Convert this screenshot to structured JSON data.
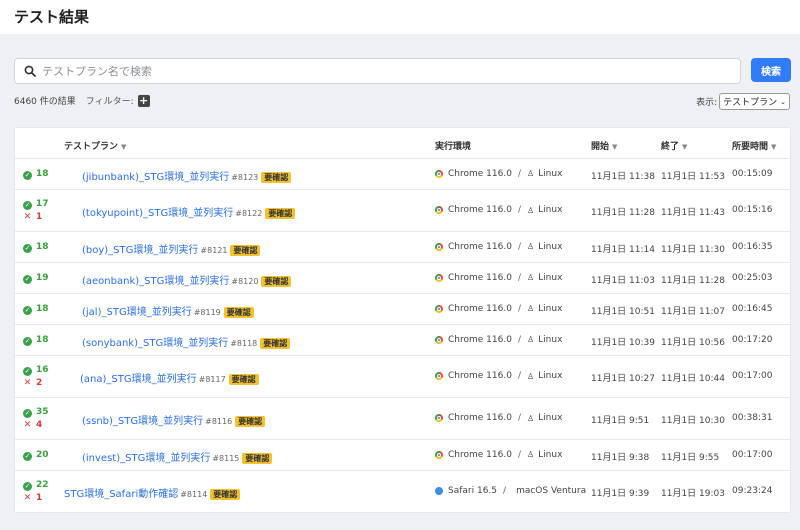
{
  "page": {
    "title": "テスト結果"
  },
  "search": {
    "placeholder": "テストプラン名で検索",
    "button_label": "検索"
  },
  "results": {
    "count_label": "6460 件の結果",
    "filter_label": "フィルター:"
  },
  "display": {
    "label": "表示:",
    "selected": "テストプラン"
  },
  "table": {
    "headers": {
      "plan": "テストプラン",
      "env": "実行環境",
      "start": "開始",
      "end": "終了",
      "duration": "所要時間"
    },
    "rows": [
      {
        "passed": "18",
        "failed": "",
        "plan": "(jibunbank)_STG環境_並列実行",
        "number": "#8123",
        "badge": "要確認",
        "browser": "Chrome 116.0",
        "browser_icon": "chrome-icon",
        "os": "Linux",
        "os_icon": "linux-icon",
        "start": "11月1日 11:38",
        "end": "11月1日 11:53",
        "duration": "00:15:09"
      },
      {
        "passed": "17",
        "failed": "1",
        "plan": "(tokyupoint)_STG環境_並列実行",
        "number": "#8122",
        "badge": "要確認",
        "browser": "Chrome 116.0",
        "browser_icon": "chrome-icon",
        "os": "Linux",
        "os_icon": "linux-icon",
        "start": "11月1日 11:28",
        "end": "11月1日 11:43",
        "duration": "00:15:16"
      },
      {
        "passed": "18",
        "failed": "",
        "plan": "(boy)_STG環境_並列実行",
        "number": "#8121",
        "badge": "要確認",
        "browser": "Chrome 116.0",
        "browser_icon": "chrome-icon",
        "os": "Linux",
        "os_icon": "linux-icon",
        "start": "11月1日 11:14",
        "end": "11月1日 11:30",
        "duration": "00:16:35"
      },
      {
        "passed": "19",
        "failed": "",
        "plan": "(aeonbank)_STG環境_並列実行",
        "number": "#8120",
        "badge": "要確認",
        "browser": "Chrome 116.0",
        "browser_icon": "chrome-icon",
        "os": "Linux",
        "os_icon": "linux-icon",
        "start": "11月1日 11:03",
        "end": "11月1日 11:28",
        "duration": "00:25:03"
      },
      {
        "passed": "18",
        "failed": "",
        "plan": "(jal)_STG環境_並列実行",
        "number": "#8119",
        "badge": "要確認",
        "browser": "Chrome 116.0",
        "browser_icon": "chrome-icon",
        "os": "Linux",
        "os_icon": "linux-icon",
        "start": "11月1日 10:51",
        "end": "11月1日 11:07",
        "duration": "00:16:45"
      },
      {
        "passed": "18",
        "failed": "",
        "plan": "(sonybank)_STG環境_並列実行",
        "number": "#8118",
        "badge": "要確認",
        "browser": "Chrome 116.0",
        "browser_icon": "chrome-icon",
        "os": "Linux",
        "os_icon": "linux-icon",
        "start": "11月1日 10:39",
        "end": "11月1日 10:56",
        "duration": "00:17:20"
      },
      {
        "passed": "16",
        "failed": "2",
        "plan": "(ana)_STG環境_並列実行",
        "number": "#8117",
        "badge": "要確認",
        "browser": "Chrome 116.0",
        "browser_icon": "chrome-icon",
        "os": "Linux",
        "os_icon": "linux-icon",
        "start": "11月1日 10:27",
        "end": "11月1日 10:44",
        "duration": "00:17:00"
      },
      {
        "passed": "35",
        "failed": "4",
        "plan": "(ssnb)_STG環境_並列実行",
        "number": "#8116",
        "badge": "要確認",
        "browser": "Chrome 116.0",
        "browser_icon": "chrome-icon",
        "os": "Linux",
        "os_icon": "linux-icon",
        "start": "11月1日 9:51",
        "end": "11月1日 10:30",
        "duration": "00:38:31"
      },
      {
        "passed": "20",
        "failed": "",
        "plan": "(invest)_STG環境_並列実行",
        "number": "#8115",
        "badge": "要確認",
        "browser": "Chrome 116.0",
        "browser_icon": "chrome-icon",
        "os": "Linux",
        "os_icon": "linux-icon",
        "start": "11月1日 9:38",
        "end": "11月1日 9:55",
        "duration": "00:17:00"
      },
      {
        "passed": "22",
        "failed": "1",
        "plan": "STG環境_Safari動作確認",
        "number": "#8114",
        "badge": "要確認",
        "browser": "Safari 16.5",
        "browser_icon": "safari-icon",
        "os": "macOS Ventura",
        "os_icon": "apple-icon",
        "start": "11月1日 9:39",
        "end": "11月1日 19:03",
        "duration": "09:23:24"
      }
    ]
  }
}
